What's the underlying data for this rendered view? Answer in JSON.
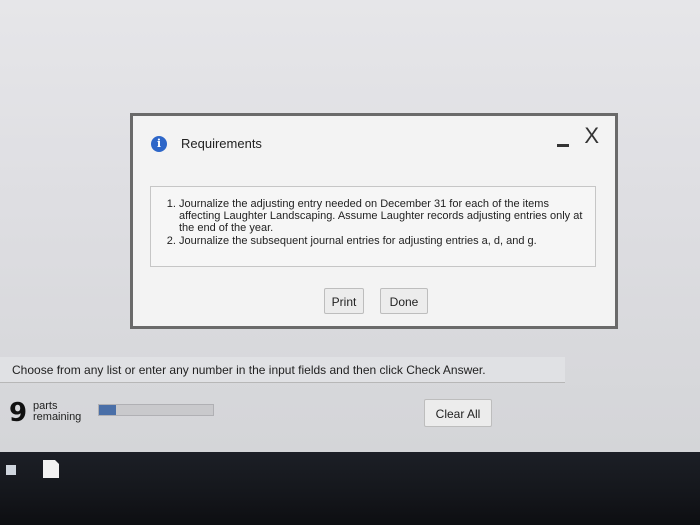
{
  "dialog": {
    "title": "Requirements",
    "close_label": "X",
    "requirements": [
      "Journalize the adjusting entry needed on December 31 for each of the items affecting Laughter Landscaping. Assume Laughter records adjusting entries only at the end of the year.",
      "Journalize the subsequent journal entries for adjusting entries a, d, and g."
    ],
    "print_label": "Print",
    "done_label": "Done"
  },
  "footer": {
    "instructions": "Choose from any list or enter any number in the input fields and then click Check Answer.",
    "parts_number": "9",
    "parts_label_1": "parts",
    "parts_label_2": "remaining",
    "progress_fraction": 0.15,
    "clear_all_label": "Clear All"
  },
  "colors": {
    "accent_blue": "#2d66c8",
    "progress_fill": "#4a6fa8"
  }
}
